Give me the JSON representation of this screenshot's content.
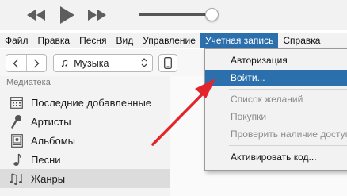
{
  "player": {
    "volume_level": 0.95
  },
  "menubar": {
    "items": [
      "Файл",
      "Правка",
      "Песня",
      "Вид",
      "Управление",
      "Учетная запись",
      "Справка"
    ],
    "active_index": 5
  },
  "toolbar": {
    "back_icon": "chevron-left-icon",
    "forward_icon": "chevron-right-icon",
    "library_icon": "music-note-icon",
    "library_label": "Музыка",
    "device_icon": "iphone-icon"
  },
  "sidebar": {
    "header": "Медиатека",
    "items": [
      {
        "label": "Последние добавленные",
        "icon": "recently-added-icon"
      },
      {
        "label": "Артисты",
        "icon": "microphone-icon"
      },
      {
        "label": "Альбомы",
        "icon": "album-icon"
      },
      {
        "label": "Песни",
        "icon": "music-note-icon"
      },
      {
        "label": "Жанры",
        "icon": "genres-icon"
      }
    ],
    "selected_index": 4
  },
  "account_menu": {
    "items": [
      {
        "label": "Авторизация",
        "state": "normal"
      },
      {
        "label": "Войти...",
        "state": "highlighted"
      },
      {
        "label": "Список желаний",
        "state": "disabled"
      },
      {
        "label": "Покупки",
        "state": "disabled"
      },
      {
        "label": "Проверить наличие доступ",
        "state": "disabled"
      },
      {
        "label": "Активировать код...",
        "state": "normal"
      }
    ]
  },
  "colors": {
    "highlight": "#2c6fad",
    "annotation_arrow": "#e3252b"
  }
}
